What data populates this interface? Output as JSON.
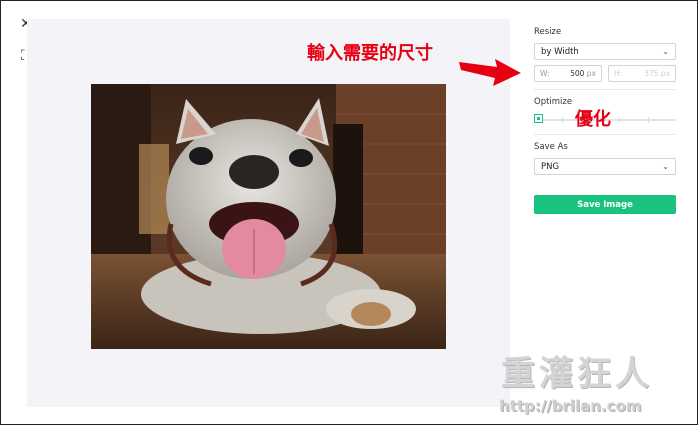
{
  "toolbar": {
    "close_icon": "close-icon",
    "crop_icon": "crop-icon",
    "close_glyph": "✕",
    "crop_glyph": "⛶"
  },
  "photo": {
    "subject": "french-bulldog-photo"
  },
  "panel": {
    "resize_label": "Resize",
    "resize_mode": "by Width",
    "width_prefix": "W:",
    "width_value": "500",
    "width_unit": "px",
    "height_prefix": "H:",
    "height_value": "375",
    "height_unit": "px",
    "optimize_label": "Optimize",
    "optimize_level": 0,
    "save_as_label": "Save As",
    "format": "PNG",
    "save_button": "Save Image"
  },
  "annotations": {
    "size_note": "輸入需要的尺寸",
    "optimize_note": "優化"
  },
  "watermark": {
    "title": "重灌狂人",
    "url": "http://briian.com"
  },
  "colors": {
    "accent": "#19c37d",
    "annotation": "#e60012",
    "canvas_bg": "#f4f4f8"
  }
}
